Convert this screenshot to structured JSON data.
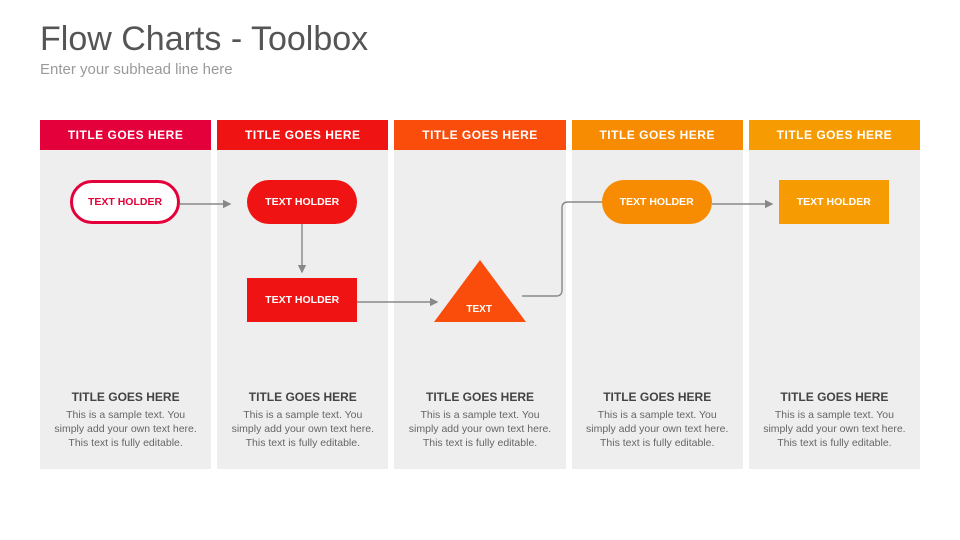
{
  "header": {
    "title": "Flow Charts - Toolbox",
    "subtitle": "Enter your subhead line here"
  },
  "columns": [
    {
      "header": "TITLE GOES HERE",
      "color": "#e4003a",
      "footer_title": "TITLE GOES HERE",
      "footer_body": "This is a sample text. You simply add your own text here. This text is fully editable."
    },
    {
      "header": "TITLE GOES HERE",
      "color": "#f01313",
      "footer_title": "TITLE GOES HERE",
      "footer_body": "This is a sample text. You simply add your own text here. This text is fully editable."
    },
    {
      "header": "TITLE GOES HERE",
      "color": "#fa4d0b",
      "footer_title": "TITLE GOES HERE",
      "footer_body": "This is a sample text. You simply add your own text here. This text is fully editable."
    },
    {
      "header": "TITLE GOES HERE",
      "color": "#f78b02",
      "footer_title": "TITLE GOES HERE",
      "footer_body": "This is a sample text. You simply add your own text here. This text is fully editable."
    },
    {
      "header": "TITLE GOES HERE",
      "color": "#f79b02",
      "footer_title": "TITLE GOES HERE",
      "footer_body": "This is a sample text. You simply add your own text here. This text is fully editable."
    }
  ],
  "nodes": {
    "n1": {
      "label": "TEXT HOLDER",
      "color": "#e4003a"
    },
    "n2": {
      "label": "TEXT HOLDER",
      "color": "#f01313"
    },
    "n3": {
      "label": "TEXT HOLDER",
      "color": "#f01313"
    },
    "n4": {
      "label": "TEXT",
      "color": "#fa4d0b"
    },
    "n5": {
      "label": "TEXT HOLDER",
      "color": "#f78b02"
    },
    "n6": {
      "label": "TEXT HOLDER",
      "color": "#f79b02"
    }
  },
  "chart_data": {
    "type": "flow-diagram",
    "nodes": [
      {
        "id": "n1",
        "shape": "pill-outline",
        "label": "TEXT HOLDER",
        "column": 0,
        "row": 0,
        "color": "#e4003a"
      },
      {
        "id": "n2",
        "shape": "pill-solid",
        "label": "TEXT HOLDER",
        "column": 1,
        "row": 0,
        "color": "#f01313"
      },
      {
        "id": "n3",
        "shape": "rect",
        "label": "TEXT HOLDER",
        "column": 1,
        "row": 1,
        "color": "#f01313"
      },
      {
        "id": "n4",
        "shape": "triangle",
        "label": "TEXT",
        "column": 2,
        "row": 1,
        "color": "#fa4d0b"
      },
      {
        "id": "n5",
        "shape": "pill-solid",
        "label": "TEXT HOLDER",
        "column": 3,
        "row": 0,
        "color": "#f78b02"
      },
      {
        "id": "n6",
        "shape": "rect",
        "label": "TEXT HOLDER",
        "column": 4,
        "row": 0,
        "color": "#f79b02"
      }
    ],
    "edges": [
      {
        "from": "n1",
        "to": "n2",
        "path": "right"
      },
      {
        "from": "n2",
        "to": "n3",
        "path": "down"
      },
      {
        "from": "n3",
        "to": "n4",
        "path": "right"
      },
      {
        "from": "n4",
        "to": "n5",
        "path": "up-then-right"
      },
      {
        "from": "n5",
        "to": "n6",
        "path": "right"
      }
    ],
    "columns": 5
  }
}
